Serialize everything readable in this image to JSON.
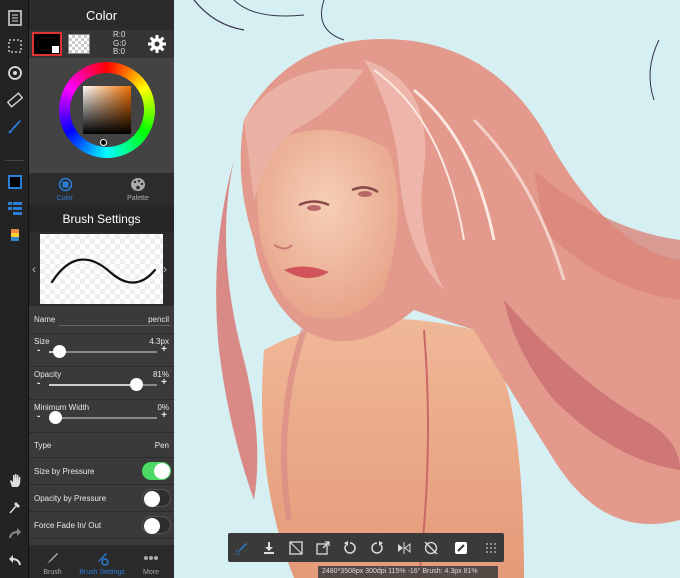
{
  "toolbar": {
    "items": [
      {
        "icon": "layers-icon"
      },
      {
        "icon": "selection-icon"
      },
      {
        "icon": "transform-icon"
      },
      {
        "icon": "ruler-icon"
      },
      {
        "icon": "brush-tool-icon"
      },
      {
        "icon": "color-swatch-icon"
      },
      {
        "icon": "layer-list-icon"
      },
      {
        "icon": "material-icon"
      },
      {
        "icon": "hand-icon"
      },
      {
        "icon": "eyedropper-icon"
      },
      {
        "icon": "redo-icon"
      },
      {
        "icon": "undo-icon"
      }
    ]
  },
  "color_panel": {
    "title": "Color",
    "rgb": {
      "r": "R:0",
      "g": "G:0",
      "b": "B:0"
    },
    "main_color": "#000000",
    "tabs": [
      {
        "label": "Color",
        "icon": "color-circle-icon",
        "active": true
      },
      {
        "label": "Palette",
        "icon": "palette-icon",
        "active": false
      }
    ]
  },
  "brush_settings": {
    "title": "Brush Settings",
    "name_label": "Name",
    "name_value": "pencil",
    "size": {
      "label": "Size",
      "value": "4.3px",
      "level": 0.1
    },
    "opacity": {
      "label": "Opacity",
      "value": "81%",
      "level": 0.81
    },
    "min_width": {
      "label": "Minimum Width",
      "value": "0%",
      "level": 0.0
    },
    "type_label": "Type",
    "type_value": "Pen",
    "size_by_pressure": {
      "label": "Size by Pressure",
      "on": true
    },
    "opacity_by_pressure": {
      "label": "Opacity by Pressure",
      "on": false
    },
    "force_fade": {
      "label": "Force Fade In/ Out",
      "on": false
    },
    "minus": "-",
    "plus": "+"
  },
  "bottom_tabs": [
    {
      "label": "Brush",
      "icon": "brush-icon"
    },
    {
      "label": "Brush Settings",
      "icon": "brush-settings-icon",
      "active": true
    },
    {
      "label": "More",
      "icon": "more-icon"
    }
  ],
  "status_bar": "2480*3508px 300dpi 115% -16° Brush: 4.3px 81%",
  "colors": {
    "accent": "#2a7ed8",
    "toggle_on": "#4cd964"
  }
}
